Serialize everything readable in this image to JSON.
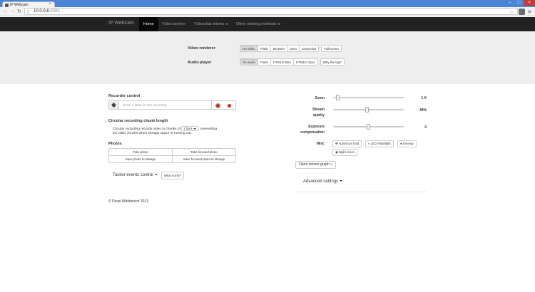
{
  "browser": {
    "tab_title": "IP Webcam",
    "address_host": "10.0.0.6",
    "address_port": ":8080",
    "accent": "#4b86d6"
  },
  "navbar": {
    "brand": "IP Webcam",
    "items": [
      "Home",
      "Video archive",
      "Videochat drivers",
      "Other viewing methods"
    ],
    "active": "Home"
  },
  "renderer": {
    "label": "Video renderer",
    "options": [
      "No video",
      "Flash",
      "Browser",
      "Java",
      "Javascript",
      "Fullscreen"
    ],
    "selected": "No video"
  },
  "audio": {
    "label": "Audio player",
    "options": [
      "No audio",
      "Flash",
      "HTML5 Wav",
      "HTML5 Opus",
      "Why the lag?"
    ],
    "selected": "No audio"
  },
  "recorder": {
    "title": "Recorder control",
    "placeholder": "Enter a label for this recording"
  },
  "chunk": {
    "title": "Circular recording chunk length",
    "line1_before": "Circular recording records video in chunks of",
    "chunk_value": "1 hour",
    "line1_after": ", overwriting",
    "line2": "the older chunks when storage space is running out."
  },
  "photos": {
    "title": "Photos",
    "buttons": [
      "Take photo",
      "Take focused photo",
      "Save photo to storage",
      "Save focused photo to storage"
    ]
  },
  "tasker": {
    "label": "Tasker events control",
    "help": "What is this?"
  },
  "controls": {
    "zoom_label": "Zoom",
    "zoom_value": "1 X",
    "quality_label1": "Stream",
    "quality_label2": "quality",
    "quality_value": "49%",
    "quality_level": 49,
    "exposure_label1": "Exposure",
    "exposure_label2": "compensation",
    "exposure_value": "0",
    "misc_label": "Misc",
    "misc_buttons": [
      "Autofocus hold",
      "LED Flashlight",
      "Overlay",
      "Night vision"
    ],
    "sensor_graph": "Open sensor graph »",
    "advanced": "Advanced settings"
  },
  "footer": "© Pavel Khlebovich 2013"
}
